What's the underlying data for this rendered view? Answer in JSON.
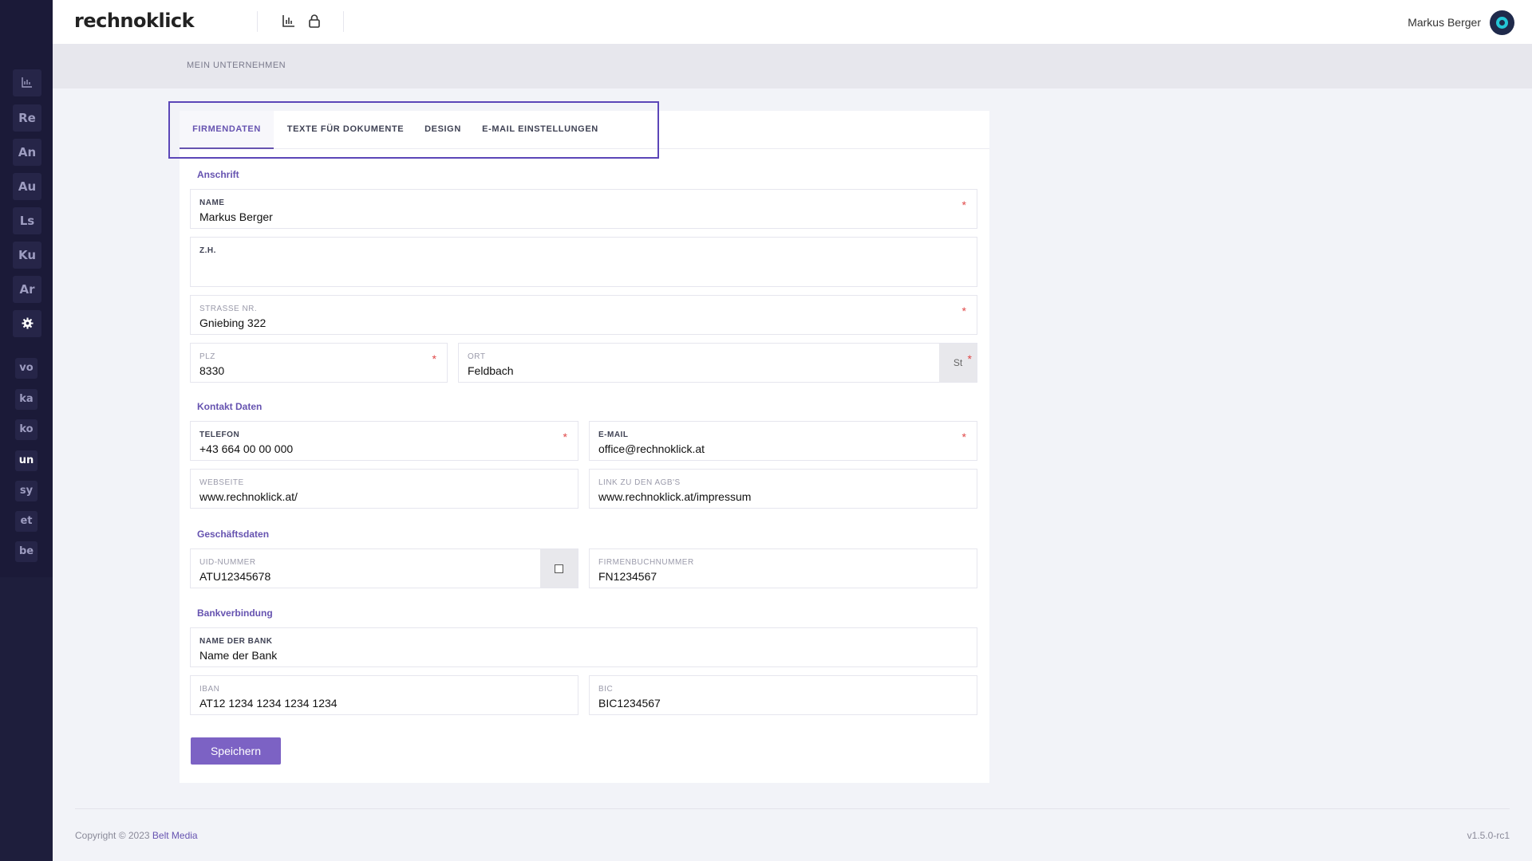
{
  "app": {
    "logo": "rechnoklick"
  },
  "header": {
    "user_name": "Markus Berger",
    "icons": [
      "chart-icon",
      "lock-icon"
    ]
  },
  "sidebar": {
    "items": [
      {
        "icon": "chart-icon"
      },
      {
        "label": "Re"
      },
      {
        "label": "An"
      },
      {
        "label": "Au"
      },
      {
        "label": "Ls"
      },
      {
        "label": "Ku"
      },
      {
        "label": "Ar"
      },
      {
        "icon": "gear-icon"
      }
    ],
    "sub_items": [
      "vo",
      "ka",
      "ko",
      "un",
      "sy",
      "et",
      "be"
    ]
  },
  "breadcrumb": "MEIN UNTERNEHMEN",
  "tabs": [
    {
      "label": "FIRMENDATEN",
      "active": true
    },
    {
      "label": "TEXTE FÜR DOKUMENTE"
    },
    {
      "label": "DESIGN"
    },
    {
      "label": "E-MAIL EINSTELLUNGEN"
    }
  ],
  "sections": {
    "anschrift": "Anschrift",
    "kontakt": "Kontakt Daten",
    "geschaeft": "Geschäftsdaten",
    "bank": "Bankverbindung"
  },
  "fields": {
    "name": {
      "label": "NAME",
      "value": "Markus Berger",
      "required": "*"
    },
    "zh": {
      "label": "Z.H.",
      "value": ""
    },
    "strasse": {
      "label": "STRASSE NR.",
      "value": "Gniebing 322",
      "required": "*"
    },
    "plz": {
      "label": "PLZ",
      "value": "8330",
      "required": "*"
    },
    "ort": {
      "label": "ORT",
      "value": "Feldbach",
      "addon": "St",
      "required": "*"
    },
    "telefon": {
      "label": "TELEFON",
      "value": "+43 664 00 00 000",
      "required": "*"
    },
    "email": {
      "label": "E-MAIL",
      "value": "office@rechnoklick.at",
      "required": "*"
    },
    "webseite": {
      "label": "WEBSEITE",
      "value": "www.rechnoklick.at/"
    },
    "agb": {
      "label": "LINK ZU DEN AGB'S",
      "value": "www.rechnoklick.at/impressum"
    },
    "uid": {
      "label": "UID-NUMMER",
      "value": "ATU12345678",
      "checked": false
    },
    "firmenbuch": {
      "label": "FIRMENBUCHNUMMER",
      "value": "FN1234567"
    },
    "bankname": {
      "label": "NAME DER BANK",
      "value": "Name der Bank"
    },
    "iban": {
      "label": "IBAN",
      "value": "AT12 1234 1234 1234 1234"
    },
    "bic": {
      "label": "BIC",
      "value": "BIC1234567"
    }
  },
  "save_label": "Speichern",
  "footer": {
    "copyright": "Copyright © 2023",
    "company": "Belt Media",
    "version": "v1.5.0-rc1"
  },
  "colors": {
    "accent": "#6653b0",
    "sidebar": "#1e1e3c",
    "required": "#e04848"
  }
}
